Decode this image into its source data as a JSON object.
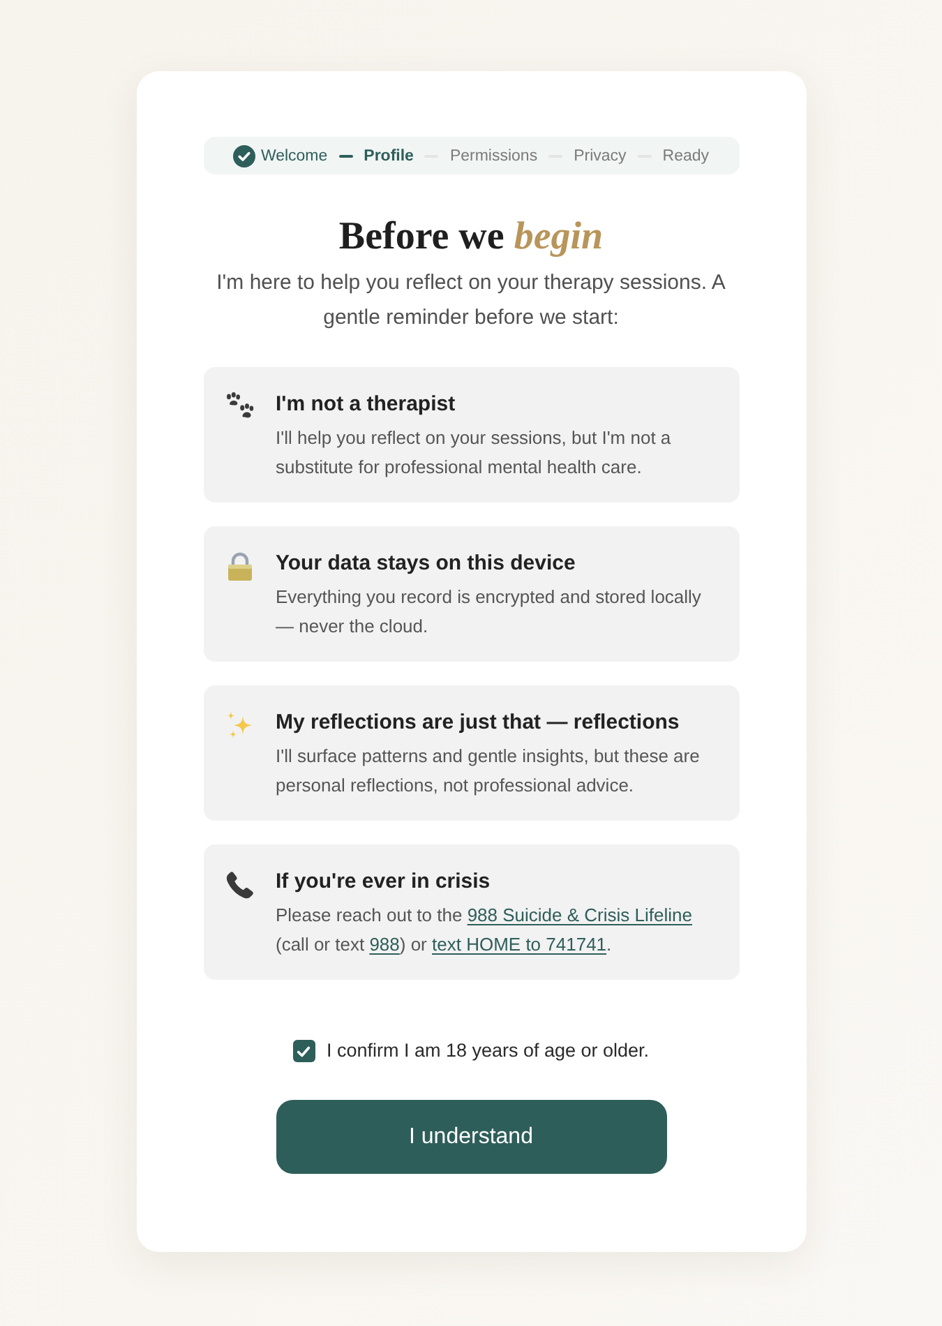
{
  "stepper": {
    "steps": [
      {
        "label": "Welcome",
        "done": true,
        "selected": false
      },
      {
        "label": "Profile",
        "done": false,
        "selected": true
      },
      {
        "label": "Permissions",
        "done": false,
        "selected": false
      },
      {
        "label": "Privacy",
        "done": false,
        "selected": false
      },
      {
        "label": "Ready",
        "done": false,
        "selected": false
      }
    ]
  },
  "heading": "Before we *begin*",
  "intro": "I'm here to help you reflect on your therapy sessions. A gentle reminder before we start:",
  "notices": [
    {
      "kind": "disclaimer",
      "title": "I'm not a therapist",
      "body": [
        {
          "kind": "text",
          "text": "I'll help you reflect on your sessions, but I'm not a substitute for professional mental health care."
        }
      ]
    },
    {
      "kind": "privacy",
      "title": "Your data stays on this device",
      "body": [
        {
          "kind": "text",
          "text": "Everything you record is encrypted and stored locally — never the cloud."
        }
      ]
    },
    {
      "kind": "insight",
      "title": "My reflections are just that — reflections",
      "body": [
        {
          "kind": "text",
          "text": "I'll surface patterns and gentle insights, but these are personal reflections, not professional advice."
        }
      ]
    },
    {
      "kind": "crisis",
      "title": "If you're ever in crisis",
      "body": [
        {
          "kind": "text",
          "text": "Please reach out to the "
        },
        {
          "kind": "link",
          "text": "988 Suicide & Crisis Lifeline"
        },
        {
          "kind": "text",
          "text": " (call or text "
        },
        {
          "kind": "link",
          "text": "988"
        },
        {
          "kind": "text",
          "text": ") or "
        },
        {
          "kind": "link",
          "text": "text HOME to 741741"
        },
        {
          "kind": "text",
          "text": "."
        }
      ]
    }
  ],
  "age_confirmation": {
    "label": "I confirm I am 18 years of age or older.",
    "checked": true
  },
  "primary_button": {
    "label": "I understand"
  }
}
